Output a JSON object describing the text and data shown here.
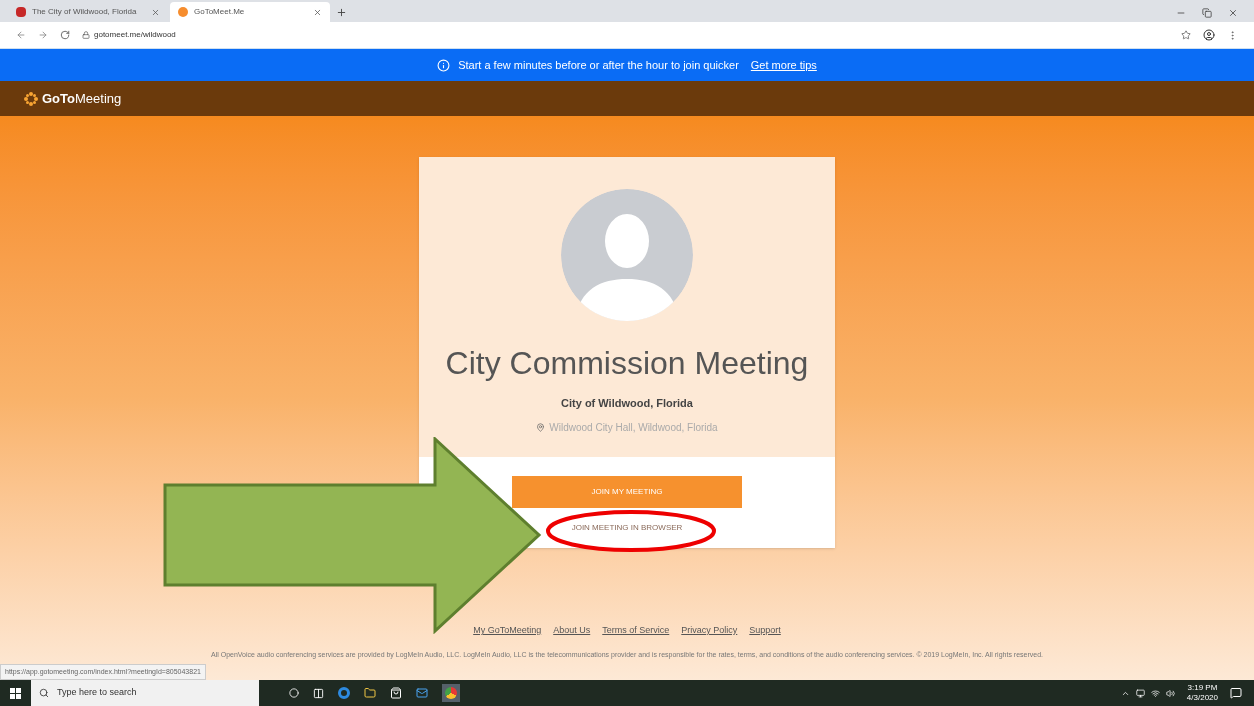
{
  "browser": {
    "tabs": [
      {
        "title": "The City of Wildwood, Florida",
        "selected": false
      },
      {
        "title": "GoToMeet.Me",
        "selected": true
      }
    ],
    "address": "gotomeet.me/wildwood"
  },
  "banner": {
    "text": "Start a few minutes before or after the hour to join quicker",
    "link": "Get more tips"
  },
  "header": {
    "logo": "**GoTo**Meeting"
  },
  "card": {
    "title": "City Commission Meeting",
    "organizer": "City of Wildwood, Florida",
    "location": "Wildwood City Hall, Wildwood, Florida",
    "primary_button": "JOIN MY MEETING",
    "secondary_link": "JOIN MEETING IN BROWSER"
  },
  "footer": {
    "links": [
      "My GoToMeeting",
      "About Us",
      "Terms of Service",
      "Privacy Policy",
      "Support"
    ],
    "legal": "All OpenVoice audio conferencing services are provided by LogMeIn Audio, LLC. LogMeIn Audio, LLC is the telecommunications provider and is responsible for the rates, terms, and conditions of the audio conferencing services. © 2019 LogMeIn, Inc. All rights reserved."
  },
  "status_url": "https://app.gotomeeting.com/index.html?meetingId=805043821",
  "taskbar": {
    "search_placeholder": "Type here to search",
    "time": "3:19 PM",
    "date": "4/3/2020"
  }
}
